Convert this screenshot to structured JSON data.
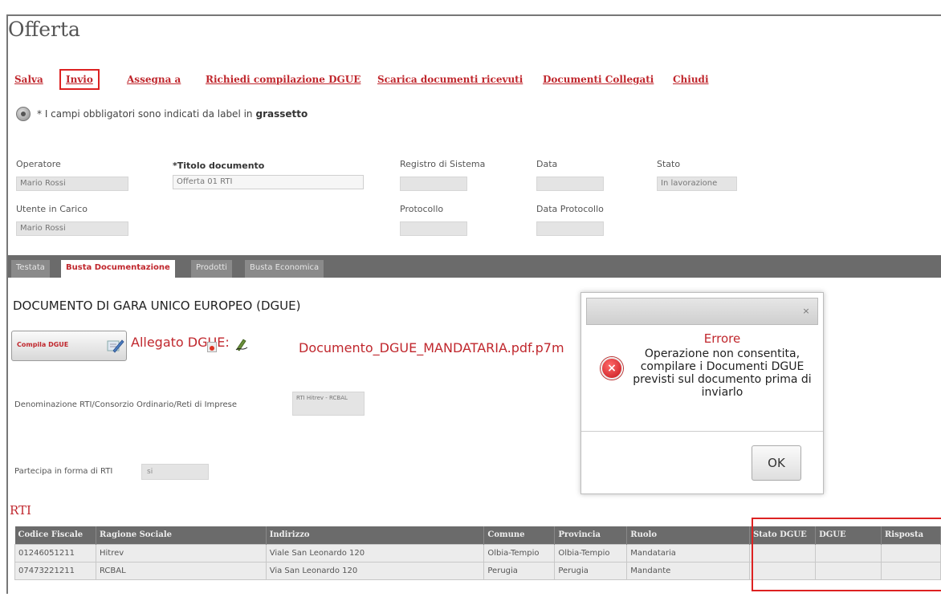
{
  "page": {
    "title": "Offerta"
  },
  "toolbar": {
    "items": [
      "Salva",
      "Invio",
      "Assegna a",
      "Richiedi compilazione DGUE",
      "Scarica documenti ricevuti",
      "Documenti Collegati",
      "Chiudi"
    ],
    "active": "Invio"
  },
  "note": {
    "text": "* I campi obbligatori sono indicati da label in",
    "bold": "grassetto"
  },
  "header_fields": {
    "operatore": {
      "label": "Operatore",
      "value": "Mario Rossi"
    },
    "titolo": {
      "label": "*Titolo documento",
      "value": "Offerta 01 RTI"
    },
    "registro": {
      "label": "Registro di Sistema",
      "value": ""
    },
    "data": {
      "label": "Data",
      "value": ""
    },
    "stato": {
      "label": "Stato",
      "value": "In lavorazione"
    },
    "utente": {
      "label": "Utente in Carico",
      "value": "Mario Rossi"
    },
    "protocollo": {
      "label": "Protocollo",
      "value": ""
    },
    "data_protocollo": {
      "label": "Data Protocollo",
      "value": ""
    }
  },
  "tabs": {
    "items": [
      "Testata",
      "Busta Documentazione",
      "Prodotti",
      "Busta Economica"
    ],
    "active": "Busta Documentazione"
  },
  "dgue": {
    "section_title": "DOCUMENTO DI GARA UNICO EUROPEO (DGUE)",
    "compila_label": "Compila DGUE",
    "allegato_label": "Allegato DGUE:",
    "file_name": "Documento_DGUE_MANDATARIA.pdf.p7m",
    "denominazione_label": "Denominazione RTI/Consorzio Ordinario/Reti di Imprese",
    "denominazione_value": "RTI Hitrev - RCBAL",
    "forma_label": "Partecipa in forma di RTI",
    "forma_value": "si"
  },
  "rti": {
    "title": "RTI",
    "columns": [
      "Codice Fiscale",
      "Ragione Sociale",
      "Indirizzo",
      "Comune",
      "Provincia",
      "Ruolo",
      "Stato DGUE",
      "DGUE",
      "Risposta"
    ],
    "rows": [
      [
        "01246051211",
        "Hitrev",
        "Viale San Leonardo 120",
        "Olbia-Tempio",
        "Olbia-Tempio",
        "Mandataria",
        "",
        "",
        ""
      ],
      [
        "07473221211",
        "RCBAL",
        "Via San Leonardo 120",
        "Perugia",
        "Perugia",
        "Mandante",
        "",
        "",
        ""
      ]
    ]
  },
  "modal": {
    "close_glyph": "×",
    "error_glyph": "×",
    "title": "Errore",
    "message": "Operazione non consentita, compilare i Documenti DGUE previsti sul documento prima di inviarlo",
    "ok_label": "OK"
  },
  "colors": {
    "accent": "#c0272d",
    "tab_bar": "#6b6b6b",
    "highlight": "#dd2222"
  }
}
